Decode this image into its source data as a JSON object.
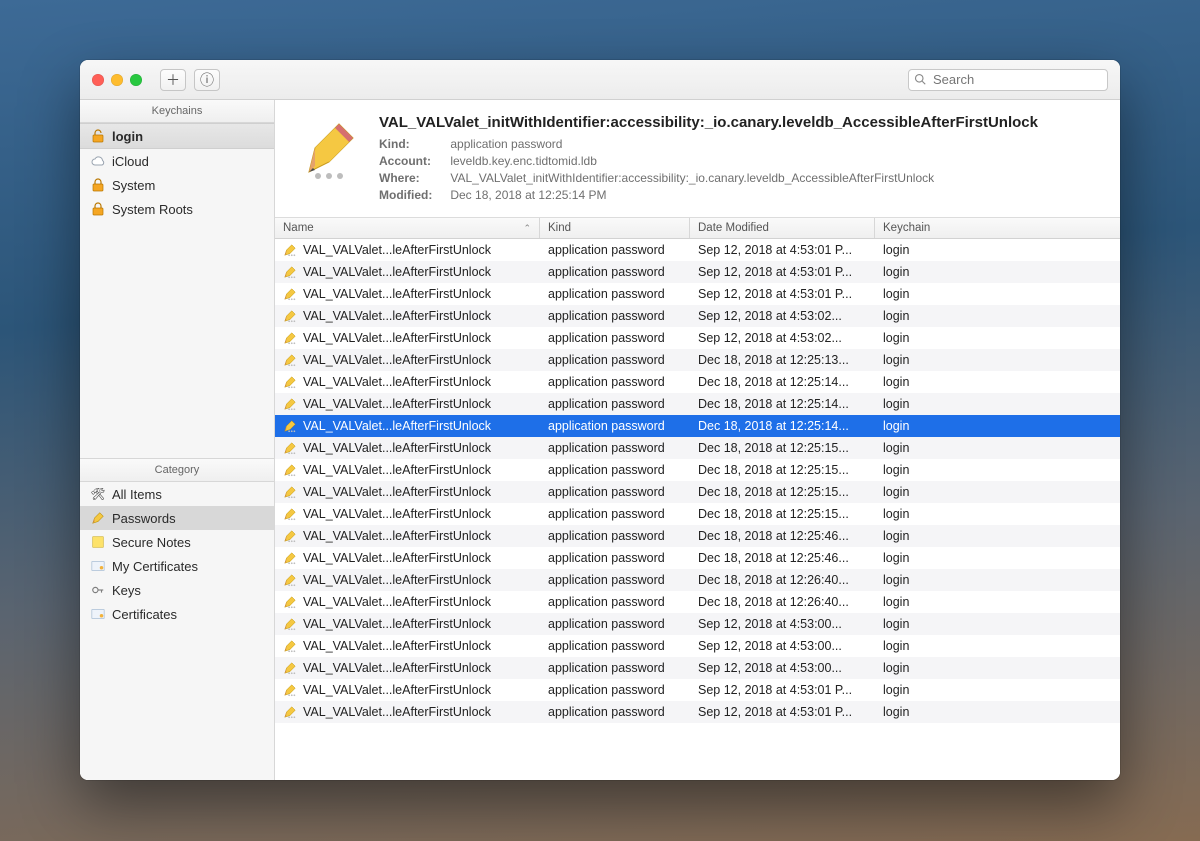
{
  "toolbar": {
    "search_placeholder": "Search"
  },
  "sidebar": {
    "keychains_header": "Keychains",
    "items": [
      {
        "label": "login",
        "icon": "lock-open"
      },
      {
        "label": "iCloud",
        "icon": "cloud"
      },
      {
        "label": "System",
        "icon": "lock"
      },
      {
        "label": "System Roots",
        "icon": "lock"
      }
    ],
    "category_header": "Category",
    "categories": [
      {
        "label": "All Items",
        "icon": "tools"
      },
      {
        "label": "Passwords",
        "icon": "pencil"
      },
      {
        "label": "Secure Notes",
        "icon": "note"
      },
      {
        "label": "My Certificates",
        "icon": "cert"
      },
      {
        "label": "Keys",
        "icon": "key"
      },
      {
        "label": "Certificates",
        "icon": "cert"
      }
    ]
  },
  "detail": {
    "title": "VAL_VALValet_initWithIdentifier:accessibility:_io.canary.leveldb_AccessibleAfterFirstUnlock",
    "kind_label": "Kind:",
    "kind_value": "application password",
    "account_label": "Account:",
    "account_value": "leveldb.key.enc.tidtomid.ldb",
    "where_label": "Where:",
    "where_value": "VAL_VALValet_initWithIdentifier:accessibility:_io.canary.leveldb_AccessibleAfterFirstUnlock",
    "modified_label": "Modified:",
    "modified_value": "Dec 18, 2018 at 12:25:14 PM"
  },
  "columns": {
    "name": "Name",
    "kind": "Kind",
    "date": "Date Modified",
    "keychain": "Keychain"
  },
  "rows": [
    {
      "name": "VAL_VALValet...leAfterFirstUnlock",
      "kind": "application password",
      "date": "Sep 12, 2018 at 4:53:01 P...",
      "keychain": "login",
      "selected": false
    },
    {
      "name": "VAL_VALValet...leAfterFirstUnlock",
      "kind": "application password",
      "date": "Sep 12, 2018 at 4:53:01 P...",
      "keychain": "login",
      "selected": false
    },
    {
      "name": "VAL_VALValet...leAfterFirstUnlock",
      "kind": "application password",
      "date": "Sep 12, 2018 at 4:53:01 P...",
      "keychain": "login",
      "selected": false
    },
    {
      "name": "VAL_VALValet...leAfterFirstUnlock",
      "kind": "application password",
      "date": "Sep 12, 2018 at 4:53:02...",
      "keychain": "login",
      "selected": false
    },
    {
      "name": "VAL_VALValet...leAfterFirstUnlock",
      "kind": "application password",
      "date": "Sep 12, 2018 at 4:53:02...",
      "keychain": "login",
      "selected": false
    },
    {
      "name": "VAL_VALValet...leAfterFirstUnlock",
      "kind": "application password",
      "date": "Dec 18, 2018 at 12:25:13...",
      "keychain": "login",
      "selected": false
    },
    {
      "name": "VAL_VALValet...leAfterFirstUnlock",
      "kind": "application password",
      "date": "Dec 18, 2018 at 12:25:14...",
      "keychain": "login",
      "selected": false
    },
    {
      "name": "VAL_VALValet...leAfterFirstUnlock",
      "kind": "application password",
      "date": "Dec 18, 2018 at 12:25:14...",
      "keychain": "login",
      "selected": false
    },
    {
      "name": "VAL_VALValet...leAfterFirstUnlock",
      "kind": "application password",
      "date": "Dec 18, 2018 at 12:25:14...",
      "keychain": "login",
      "selected": true
    },
    {
      "name": "VAL_VALValet...leAfterFirstUnlock",
      "kind": "application password",
      "date": "Dec 18, 2018 at 12:25:15...",
      "keychain": "login",
      "selected": false
    },
    {
      "name": "VAL_VALValet...leAfterFirstUnlock",
      "kind": "application password",
      "date": "Dec 18, 2018 at 12:25:15...",
      "keychain": "login",
      "selected": false
    },
    {
      "name": "VAL_VALValet...leAfterFirstUnlock",
      "kind": "application password",
      "date": "Dec 18, 2018 at 12:25:15...",
      "keychain": "login",
      "selected": false
    },
    {
      "name": "VAL_VALValet...leAfterFirstUnlock",
      "kind": "application password",
      "date": "Dec 18, 2018 at 12:25:15...",
      "keychain": "login",
      "selected": false
    },
    {
      "name": "VAL_VALValet...leAfterFirstUnlock",
      "kind": "application password",
      "date": "Dec 18, 2018 at 12:25:46...",
      "keychain": "login",
      "selected": false
    },
    {
      "name": "VAL_VALValet...leAfterFirstUnlock",
      "kind": "application password",
      "date": "Dec 18, 2018 at 12:25:46...",
      "keychain": "login",
      "selected": false
    },
    {
      "name": "VAL_VALValet...leAfterFirstUnlock",
      "kind": "application password",
      "date": "Dec 18, 2018 at 12:26:40...",
      "keychain": "login",
      "selected": false
    },
    {
      "name": "VAL_VALValet...leAfterFirstUnlock",
      "kind": "application password",
      "date": "Dec 18, 2018 at 12:26:40...",
      "keychain": "login",
      "selected": false
    },
    {
      "name": "VAL_VALValet...leAfterFirstUnlock",
      "kind": "application password",
      "date": "Sep 12, 2018 at 4:53:00...",
      "keychain": "login",
      "selected": false
    },
    {
      "name": "VAL_VALValet...leAfterFirstUnlock",
      "kind": "application password",
      "date": "Sep 12, 2018 at 4:53:00...",
      "keychain": "login",
      "selected": false
    },
    {
      "name": "VAL_VALValet...leAfterFirstUnlock",
      "kind": "application password",
      "date": "Sep 12, 2018 at 4:53:00...",
      "keychain": "login",
      "selected": false
    },
    {
      "name": "VAL_VALValet...leAfterFirstUnlock",
      "kind": "application password",
      "date": "Sep 12, 2018 at 4:53:01 P...",
      "keychain": "login",
      "selected": false
    },
    {
      "name": "VAL_VALValet...leAfterFirstUnlock",
      "kind": "application password",
      "date": "Sep 12, 2018 at 4:53:01 P...",
      "keychain": "login",
      "selected": false
    }
  ]
}
